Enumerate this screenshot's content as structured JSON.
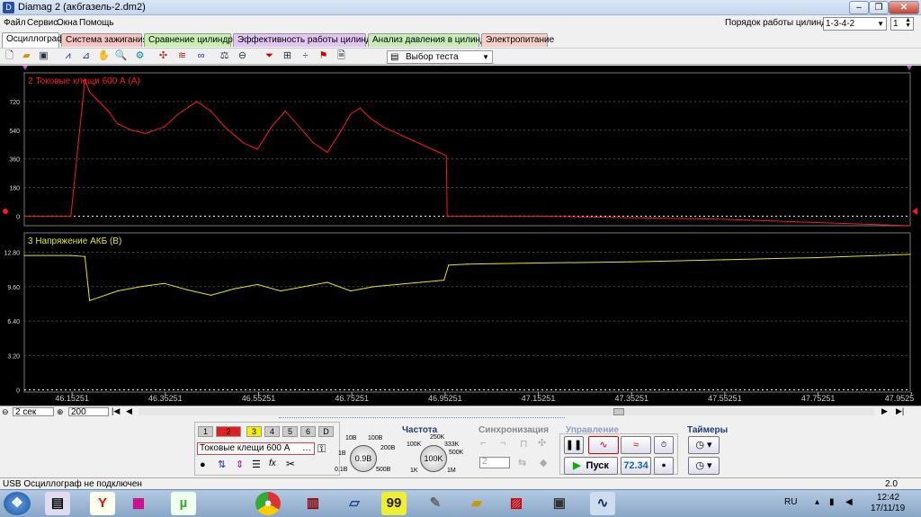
{
  "window": {
    "title": "Diamag 2 (акбгазель-2.dm2)",
    "icon": "D"
  },
  "menu": [
    "Файл",
    "Сервис",
    "Окна",
    "Помощь"
  ],
  "cylinder": {
    "label": "Порядок работы цилиндров",
    "value": "1-3-4-2",
    "spin": "1"
  },
  "tabs": [
    {
      "label": "Осциллограф",
      "color": "#ffffff"
    },
    {
      "label": "Система зажигания",
      "color": "#f6c6c6"
    },
    {
      "label": "Сравнение цилиндров",
      "color": "#c6efb0"
    },
    {
      "label": "Эффективность работы цилиндров",
      "color": "#e2c6f2"
    },
    {
      "label": "Анализ давления в цилиндре",
      "color": "#c6ecb8"
    },
    {
      "label": "Электропитание",
      "color": "#f6cfc6"
    }
  ],
  "toolbar": {
    "test_select": "Выбор теста"
  },
  "colors": {
    "current": "#ff1a1a",
    "voltage": "#e8e800",
    "grid": "#4a4a4a"
  },
  "chart_data": [
    {
      "type": "line",
      "title": "2 Токовые клещи 600 А (А)",
      "ylim": [
        -60,
        900
      ],
      "yticks": [
        "720",
        "540",
        "360",
        "180",
        "0"
      ],
      "series": [
        {
          "name": "2 Токовые клещи 600 А (А)",
          "x": [
            46.05,
            46.15,
            46.18,
            46.19,
            46.21,
            46.23,
            46.25,
            46.28,
            46.31,
            46.35,
            46.38,
            46.42,
            46.45,
            46.48,
            46.52,
            46.55,
            46.58,
            46.61,
            46.64,
            46.67,
            46.7,
            46.73,
            46.75,
            46.77,
            46.79,
            46.82,
            46.85,
            46.88,
            46.91,
            46.94,
            46.955,
            46.957,
            47.0,
            47.15,
            47.35,
            47.55,
            47.75,
            47.95
          ],
          "values": [
            0,
            0,
            860,
            780,
            720,
            660,
            580,
            540,
            520,
            560,
            640,
            720,
            660,
            560,
            460,
            420,
            560,
            660,
            560,
            460,
            400,
            540,
            640,
            680,
            620,
            560,
            520,
            480,
            440,
            400,
            380,
            0,
            0,
            0,
            -10,
            -20,
            -40,
            -60
          ]
        }
      ]
    },
    {
      "type": "line",
      "title": "3 Напряжение АКБ (В)",
      "ylim": [
        -0.2,
        14.6
      ],
      "yticks": [
        "12.80",
        "9.60",
        "6.40",
        "3.20",
        "0"
      ],
      "xticks": [
        "46.15251",
        "46.35251",
        "46.55251",
        "46.75251",
        "46.95251",
        "47.15251",
        "47.35251",
        "47.55251",
        "47.75251",
        "47.9525"
      ],
      "series": [
        {
          "name": "3 Напряжение АКБ (В)",
          "x": [
            46.05,
            46.15,
            46.18,
            46.19,
            46.21,
            46.25,
            46.3,
            46.35,
            46.4,
            46.45,
            46.5,
            46.55,
            46.6,
            46.65,
            46.7,
            46.75,
            46.8,
            46.85,
            46.9,
            46.95,
            46.96,
            47.0,
            47.15,
            47.35,
            47.55,
            47.75,
            47.95
          ],
          "values": [
            12.5,
            12.5,
            12.4,
            8.3,
            8.6,
            9.2,
            9.6,
            9.9,
            9.3,
            8.8,
            9.4,
            9.8,
            9.2,
            9.6,
            10.0,
            9.2,
            9.6,
            9.8,
            10.0,
            10.2,
            11.6,
            11.7,
            11.8,
            11.9,
            12.1,
            12.3,
            12.6
          ]
        }
      ]
    }
  ],
  "scroll": {
    "time": "2 сек",
    "points": "200"
  },
  "channels": [
    "1",
    "2",
    "3",
    "4",
    "5",
    "6",
    "D"
  ],
  "sensor": {
    "name": "Токовые клещи 600 А",
    "voltage_value": "0.9В",
    "voltage_labels": [
      "10В",
      "100В",
      "200В",
      "500В",
      "1В",
      "0.1В"
    ]
  },
  "frequency": {
    "title": "Частота",
    "value": "100K",
    "labels": [
      "250K",
      "100K",
      "333K",
      "500K",
      "1K",
      "1M"
    ]
  },
  "sync": {
    "title": "Синхронизация",
    "value": "2"
  },
  "control": {
    "title": "Управление",
    "start": "Пуск",
    "reading": "72.34"
  },
  "timers": {
    "title": "Таймеры"
  },
  "status": {
    "left": "USB Осциллограф не подключен",
    "right": "2.0"
  },
  "taskbar": {
    "lang": "RU",
    "time": "12:42",
    "date": "17/11/19"
  }
}
